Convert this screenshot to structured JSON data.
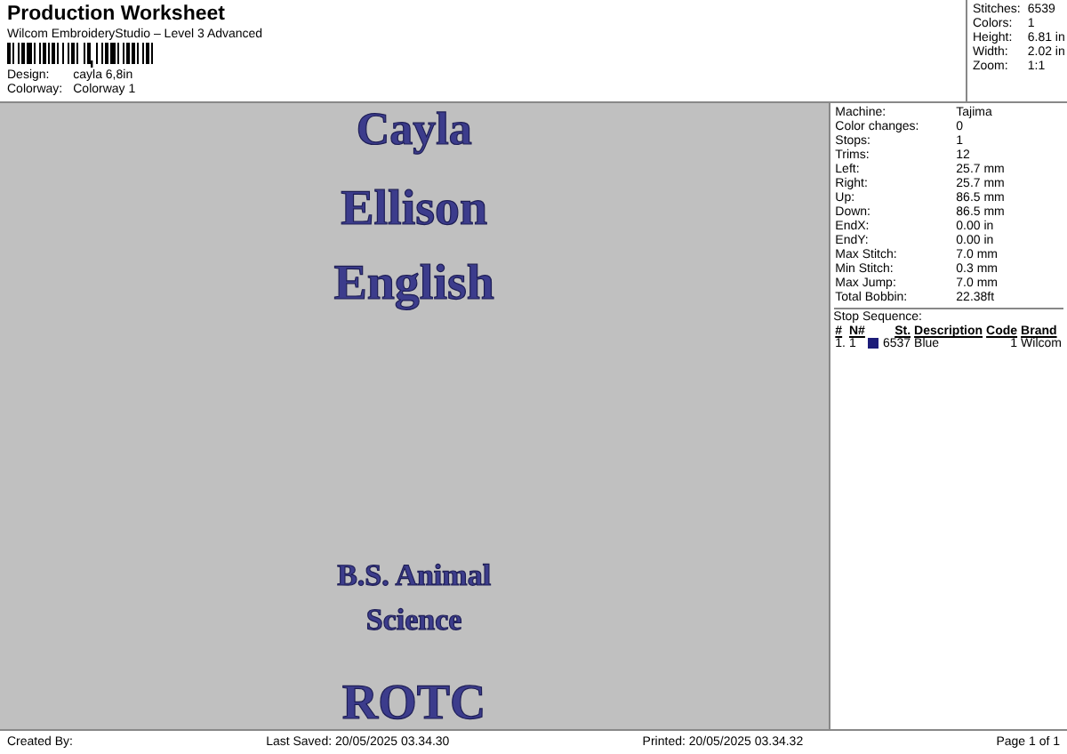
{
  "header": {
    "title": "Production Worksheet",
    "subtitle": "Wilcom EmbroideryStudio – Level 3 Advanced",
    "fields": [
      {
        "label": "Design:",
        "value": "cayla 6,8in"
      },
      {
        "label": "Colorway:",
        "value": "Colorway 1"
      }
    ]
  },
  "summary": [
    {
      "label": "Stitches:",
      "value": "6539"
    },
    {
      "label": "Colors:",
      "value": "1"
    },
    {
      "label": "Height:",
      "value": "6.81 in"
    },
    {
      "label": "Width:",
      "value": "2.02 in"
    },
    {
      "label": "Zoom:",
      "value": "1:1"
    }
  ],
  "design": {
    "blocks": [
      [
        "Cayla",
        "Ellison",
        "English"
      ],
      [
        "B.S. Animal",
        "Science"
      ],
      [
        "ROTC"
      ]
    ]
  },
  "details": [
    {
      "label": "Machine:",
      "value": "Tajima"
    },
    {
      "label": "Color changes:",
      "value": "0"
    },
    {
      "label": "Stops:",
      "value": "1"
    },
    {
      "label": "Trims:",
      "value": "12"
    },
    {
      "label": "Left:",
      "value": "25.7 mm"
    },
    {
      "label": "Right:",
      "value": "25.7 mm"
    },
    {
      "label": "Up:",
      "value": "86.5 mm"
    },
    {
      "label": "Down:",
      "value": "86.5 mm"
    },
    {
      "label": "EndX:",
      "value": "0.00 in"
    },
    {
      "label": "EndY:",
      "value": "0.00 in"
    },
    {
      "label": "Max Stitch:",
      "value": "7.0 mm"
    },
    {
      "label": "Min Stitch:",
      "value": "0.3 mm"
    },
    {
      "label": "Max Jump:",
      "value": "7.0 mm"
    },
    {
      "label": "Total Bobbin:",
      "value": "22.38ft"
    }
  ],
  "stop_sequence": {
    "title": "Stop Sequence:",
    "columns": [
      "#",
      "N#",
      "St.",
      "Description",
      "Code",
      "Brand"
    ],
    "rows": [
      {
        "index": "1.",
        "needle": "1",
        "color": "#1c1c78",
        "stitches": "6537",
        "description": "Blue",
        "code": "1",
        "brand": "Wilcom"
      }
    ]
  },
  "footer": {
    "created": "Created By:",
    "saved": "Last Saved: 20/05/2025 03.34.30",
    "printed": "Printed: 20/05/2025 03.34.32",
    "page": "Page 1 of 1"
  }
}
